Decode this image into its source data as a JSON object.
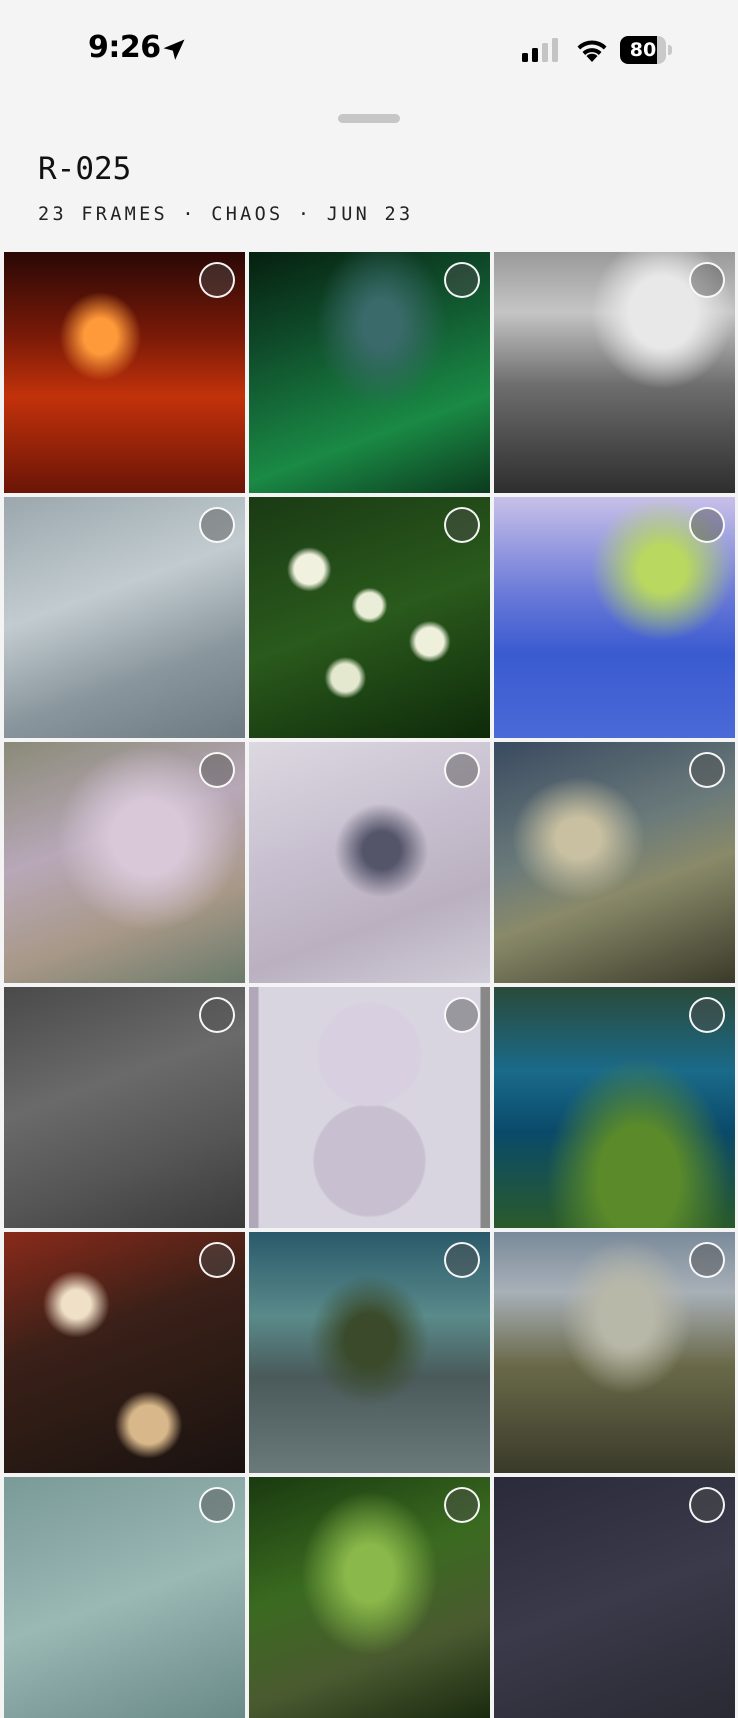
{
  "status_bar": {
    "time": "9:26",
    "battery_level": "80",
    "icons": [
      "location-arrow-icon",
      "cellular-signal-icon",
      "wifi-icon",
      "battery-icon"
    ]
  },
  "header": {
    "title": "R-025",
    "subtitle": "23 FRAMES · CHAOS · JUN 23"
  },
  "frames": [
    {
      "description": "red stairwell",
      "selected": false
    },
    {
      "description": "green tree",
      "selected": false
    },
    {
      "description": "greenhouse roof and clouds",
      "selected": false
    },
    {
      "description": "grey concrete",
      "selected": false
    },
    {
      "description": "white flowers",
      "selected": false
    },
    {
      "description": "blue pond with leaves",
      "selected": false
    },
    {
      "description": "pond with lily pads",
      "selected": false
    },
    {
      "description": "pale lily pads",
      "selected": false
    },
    {
      "description": "water ripples",
      "selected": false
    },
    {
      "description": "dark water",
      "selected": false
    },
    {
      "description": "two round mirrors",
      "selected": false
    },
    {
      "description": "blue pond with frames",
      "selected": false
    },
    {
      "description": "red bokeh",
      "selected": false
    },
    {
      "description": "teal plants",
      "selected": false
    },
    {
      "description": "greenhouse",
      "selected": false
    },
    {
      "description": "sand ripples",
      "selected": false
    },
    {
      "description": "green foliage",
      "selected": false
    },
    {
      "description": "dark sky tree",
      "selected": false
    }
  ],
  "colors": {
    "background": "#f4f4f4",
    "text": "#111111"
  }
}
